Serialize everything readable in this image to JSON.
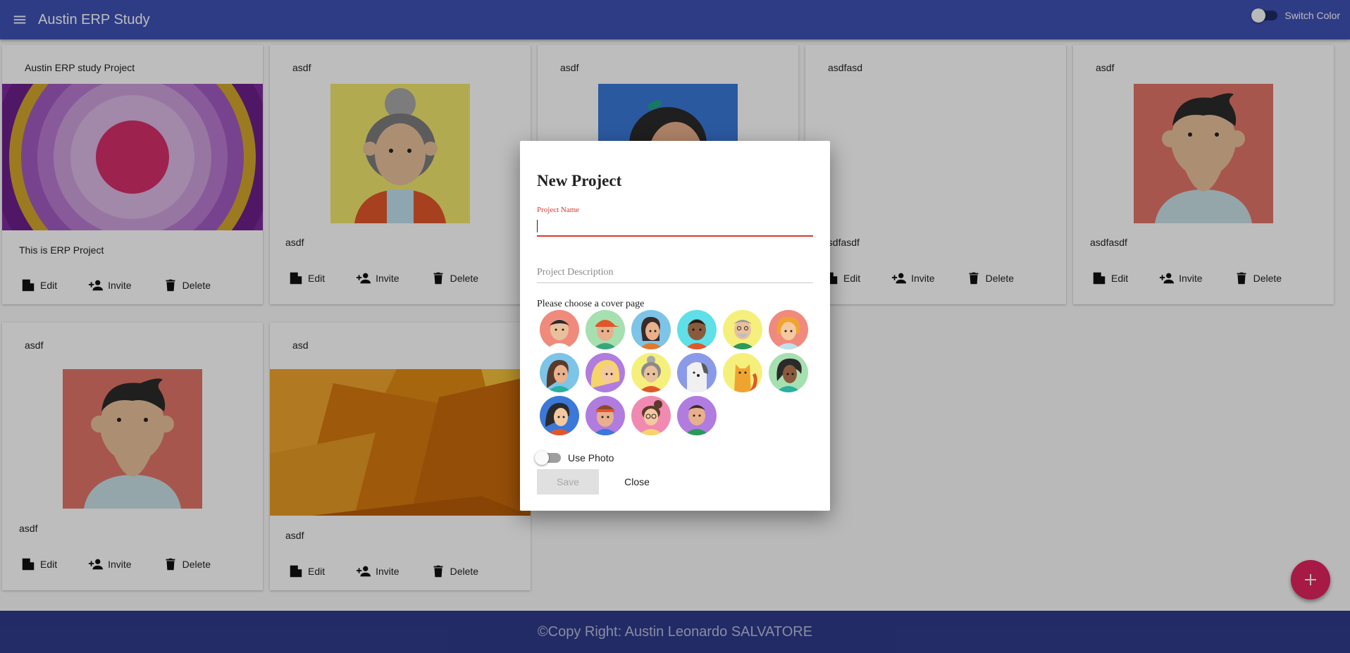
{
  "header": {
    "title": "Austin ERP Study",
    "switch_label": "Switch Color"
  },
  "cards": [
    {
      "title": "Austin ERP study Project",
      "description": "This is ERP Project",
      "cover": "radial-rings"
    },
    {
      "title": "asdf",
      "description": "asdf",
      "cover": "avatar-grandma"
    },
    {
      "title": "asdf",
      "description": "",
      "cover": "avatar-ponytail-girl"
    },
    {
      "title": "asdfasd",
      "description": "asdfasdf",
      "cover": "none"
    },
    {
      "title": "asdf",
      "description": "asdfasdf",
      "cover": "avatar-boy"
    },
    {
      "title": "asdf",
      "description": "asdf",
      "cover": "avatar-boy"
    },
    {
      "title": "asd",
      "description": "asdf",
      "cover": "orange-abstract"
    }
  ],
  "card_actions": {
    "edit": "Edit",
    "invite": "Invite",
    "delete": "Delete"
  },
  "dialog": {
    "title": "New Project",
    "name_label": "Project Name",
    "name_value": "",
    "description_placeholder": "Project Description",
    "cover_label": "Please choose a cover page",
    "use_photo_label": "Use Photo",
    "save_label": "Save",
    "close_label": "Close",
    "avatar_options": [
      "avatar-man-pink",
      "avatar-cap-boy",
      "avatar-girl-blue",
      "avatar-dark-man",
      "avatar-old-man",
      "avatar-girl-orange",
      "avatar-woman-brown",
      "avatar-blonde-woman",
      "avatar-grandma",
      "avatar-dog",
      "avatar-cat",
      "avatar-dark-woman",
      "avatar-ponytail-girl",
      "avatar-headband-boy",
      "avatar-glasses-woman",
      "avatar-man-purple"
    ]
  },
  "footer": {
    "text": "©Copy Right: Austin Leonardo SALVATORE"
  },
  "colors": {
    "primary": "#3f51b5",
    "footer": "#2f3b8a",
    "accent": "#e0245e",
    "error": "#d9382d"
  }
}
